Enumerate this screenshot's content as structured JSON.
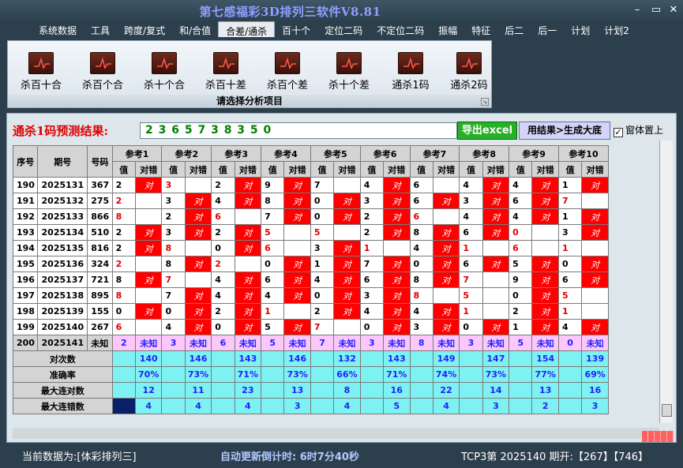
{
  "app": {
    "title": "第七感福彩3D排列三软件V8.81"
  },
  "window_controls": {
    "minimize": "–",
    "restore": "▭",
    "close": "✕"
  },
  "menu": [
    "系统数据",
    "工具",
    "跨度/复式",
    "和/合值",
    "合差/通杀",
    "百十个",
    "定位二码",
    "不定位二码",
    "振幅",
    "特征",
    "后二",
    "后一",
    "计划",
    "计划2"
  ],
  "active_menu": "合差/通杀",
  "ribbon": {
    "buttons": [
      "杀百十合",
      "杀百个合",
      "杀十个合",
      "杀百十差",
      "杀百个差",
      "杀十个差",
      "通杀1码",
      "通杀2码"
    ],
    "caption": "请选择分析项目"
  },
  "prediction": {
    "label": "通杀1码预测结果:",
    "values": "2 3 6 5 7 3 8 3 5 0",
    "excel_button": "导出excel",
    "generate_button": "用结果>生成大底",
    "always_on_top": "窗体置上"
  },
  "table": {
    "header_row1": [
      "序号",
      "期号",
      "号码",
      "参考1",
      "参考2",
      "参考3",
      "参考4",
      "参考5",
      "参考6",
      "参考7",
      "参考8",
      "参考9",
      "参考10"
    ],
    "header_row2": [
      "值",
      "对错"
    ],
    "right_mark": "对",
    "rows": [
      {
        "seq": "190",
        "period": "2025131",
        "num": "367",
        "refs": [
          [
            "2",
            "对"
          ],
          [
            "3",
            ""
          ],
          [
            "2",
            "对"
          ],
          [
            "9",
            "对"
          ],
          [
            "7",
            ""
          ],
          [
            "4",
            "对"
          ],
          [
            "6",
            ""
          ],
          [
            "4",
            "对"
          ],
          [
            "4",
            "对"
          ],
          [
            "1",
            "对"
          ]
        ]
      },
      {
        "seq": "191",
        "period": "2025132",
        "num": "275",
        "refs": [
          [
            "2",
            ""
          ],
          [
            "3",
            "对"
          ],
          [
            "4",
            "对"
          ],
          [
            "8",
            "对"
          ],
          [
            "0",
            "对"
          ],
          [
            "3",
            "对"
          ],
          [
            "6",
            "对"
          ],
          [
            "3",
            "对"
          ],
          [
            "6",
            "对"
          ],
          [
            "7",
            ""
          ]
        ]
      },
      {
        "seq": "192",
        "period": "2025133",
        "num": "866",
        "refs": [
          [
            "8",
            ""
          ],
          [
            "2",
            "对"
          ],
          [
            "6",
            ""
          ],
          [
            "7",
            "对"
          ],
          [
            "0",
            "对"
          ],
          [
            "2",
            "对"
          ],
          [
            "6",
            ""
          ],
          [
            "4",
            "对"
          ],
          [
            "4",
            "对"
          ],
          [
            "1",
            "对"
          ]
        ]
      },
      {
        "seq": "193",
        "period": "2025134",
        "num": "510",
        "refs": [
          [
            "2",
            "对"
          ],
          [
            "3",
            "对"
          ],
          [
            "2",
            "对"
          ],
          [
            "5",
            ""
          ],
          [
            "5",
            ""
          ],
          [
            "2",
            "对"
          ],
          [
            "8",
            "对"
          ],
          [
            "6",
            "对"
          ],
          [
            "0",
            ""
          ],
          [
            "3",
            "对"
          ]
        ]
      },
      {
        "seq": "194",
        "period": "2025135",
        "num": "816",
        "refs": [
          [
            "2",
            "对"
          ],
          [
            "8",
            ""
          ],
          [
            "0",
            "对"
          ],
          [
            "6",
            ""
          ],
          [
            "3",
            "对"
          ],
          [
            "1",
            ""
          ],
          [
            "4",
            "对"
          ],
          [
            "1",
            ""
          ],
          [
            "6",
            ""
          ],
          [
            "1",
            ""
          ]
        ]
      },
      {
        "seq": "195",
        "period": "2025136",
        "num": "324",
        "refs": [
          [
            "2",
            ""
          ],
          [
            "8",
            "对"
          ],
          [
            "2",
            ""
          ],
          [
            "0",
            "对"
          ],
          [
            "1",
            "对"
          ],
          [
            "7",
            "对"
          ],
          [
            "0",
            "对"
          ],
          [
            "6",
            "对"
          ],
          [
            "5",
            "对"
          ],
          [
            "0",
            "对"
          ]
        ]
      },
      {
        "seq": "196",
        "period": "2025137",
        "num": "721",
        "refs": [
          [
            "8",
            "对"
          ],
          [
            "7",
            ""
          ],
          [
            "4",
            "对"
          ],
          [
            "6",
            "对"
          ],
          [
            "4",
            "对"
          ],
          [
            "6",
            "对"
          ],
          [
            "8",
            "对"
          ],
          [
            "7",
            ""
          ],
          [
            "9",
            "对"
          ],
          [
            "6",
            "对"
          ]
        ]
      },
      {
        "seq": "197",
        "period": "2025138",
        "num": "895",
        "refs": [
          [
            "8",
            ""
          ],
          [
            "7",
            "对"
          ],
          [
            "4",
            "对"
          ],
          [
            "4",
            "对"
          ],
          [
            "0",
            "对"
          ],
          [
            "3",
            "对"
          ],
          [
            "8",
            ""
          ],
          [
            "5",
            ""
          ],
          [
            "0",
            "对"
          ],
          [
            "5",
            ""
          ]
        ]
      },
      {
        "seq": "198",
        "period": "2025139",
        "num": "155",
        "refs": [
          [
            "0",
            "对"
          ],
          [
            "0",
            "对"
          ],
          [
            "2",
            "对"
          ],
          [
            "1",
            ""
          ],
          [
            "2",
            "对"
          ],
          [
            "4",
            "对"
          ],
          [
            "4",
            "对"
          ],
          [
            "1",
            ""
          ],
          [
            "2",
            "对"
          ],
          [
            "1",
            ""
          ]
        ]
      },
      {
        "seq": "199",
        "period": "2025140",
        "num": "267",
        "refs": [
          [
            "6",
            ""
          ],
          [
            "4",
            "对"
          ],
          [
            "0",
            "对"
          ],
          [
            "5",
            "对"
          ],
          [
            "7",
            ""
          ],
          [
            "0",
            "对"
          ],
          [
            "3",
            "对"
          ],
          [
            "0",
            "对"
          ],
          [
            "1",
            "对"
          ],
          [
            "4",
            "对"
          ]
        ]
      }
    ],
    "red_value_cells": [
      [
        0,
        1
      ],
      [
        1,
        0
      ],
      [
        1,
        9
      ],
      [
        2,
        0
      ],
      [
        2,
        2
      ],
      [
        2,
        6
      ],
      [
        3,
        3
      ],
      [
        3,
        4
      ],
      [
        3,
        8
      ],
      [
        4,
        1
      ],
      [
        4,
        3
      ],
      [
        4,
        5
      ],
      [
        4,
        7
      ],
      [
        4,
        8
      ],
      [
        4,
        9
      ],
      [
        5,
        0
      ],
      [
        5,
        2
      ],
      [
        6,
        1
      ],
      [
        6,
        7
      ],
      [
        7,
        0
      ],
      [
        7,
        6
      ],
      [
        7,
        7
      ],
      [
        7,
        9
      ],
      [
        8,
        3
      ],
      [
        8,
        7
      ],
      [
        8,
        9
      ],
      [
        9,
        0
      ],
      [
        9,
        4
      ]
    ],
    "pred_row": {
      "seq": "200",
      "period": "2025141",
      "num": "未知",
      "refs": [
        [
          "2",
          "未知"
        ],
        [
          "3",
          "未知"
        ],
        [
          "6",
          "未知"
        ],
        [
          "5",
          "未知"
        ],
        [
          "7",
          "未知"
        ],
        [
          "3",
          "未知"
        ],
        [
          "8",
          "未知"
        ],
        [
          "3",
          "未知"
        ],
        [
          "5",
          "未知"
        ],
        [
          "0",
          "未知"
        ]
      ]
    },
    "stats": [
      {
        "label": "对次数",
        "values": [
          "140",
          "146",
          "143",
          "146",
          "132",
          "143",
          "149",
          "147",
          "154",
          "139"
        ]
      },
      {
        "label": "准确率",
        "values": [
          "70%",
          "73%",
          "71%",
          "73%",
          "66%",
          "71%",
          "74%",
          "73%",
          "77%",
          "69%"
        ]
      },
      {
        "label": "最大连对数",
        "values": [
          "12",
          "11",
          "23",
          "13",
          "8",
          "16",
          "22",
          "14",
          "13",
          "16"
        ]
      },
      {
        "label": "最大连错数",
        "values": [
          "4",
          "4",
          "4",
          "3",
          "4",
          "5",
          "4",
          "3",
          "2",
          "3"
        ]
      }
    ]
  },
  "status": {
    "current": "当前数据为:[体彩排列三]",
    "countdown": "自动更新倒计时: 6时7分40秒",
    "info": "TCP3第 2025140 期开:【267】【746】"
  },
  "colors": {
    "accent_red": "#ff0000",
    "stat_cyan": "#7ef2f2",
    "pred_pink": "#fcc8fc",
    "pred_blue": "#2020ff",
    "title_blue": "#8f9fff",
    "excel_green": "#28b028"
  }
}
